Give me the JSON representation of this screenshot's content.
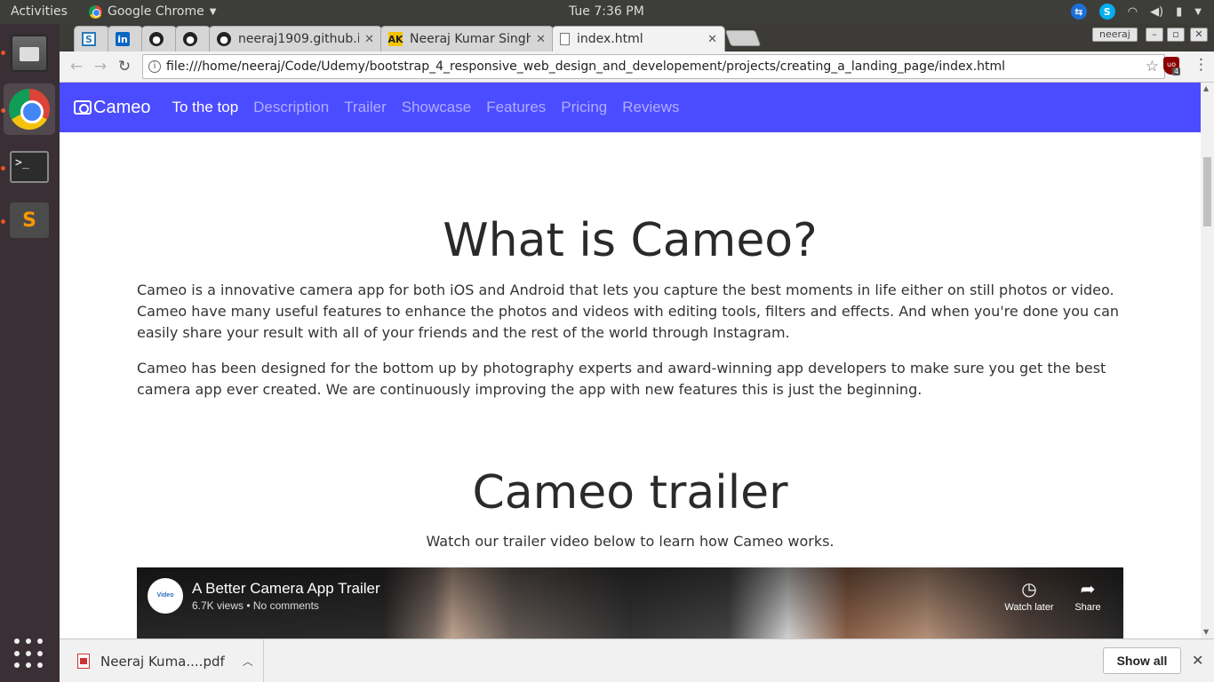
{
  "system_bar": {
    "activities": "Activities",
    "app_name": "Google Chrome",
    "clock": "Tue  7:36 PM"
  },
  "browser": {
    "tabs": [
      {
        "label": "",
        "favicon": "S"
      },
      {
        "label": "",
        "favicon": "in"
      },
      {
        "label": "",
        "favicon": "github"
      },
      {
        "label": "",
        "favicon": "github"
      },
      {
        "label": "neeraj1909.github.i",
        "favicon": "github"
      },
      {
        "label": "Neeraj Kumar Singh",
        "favicon": "AK"
      },
      {
        "label": "index.html",
        "favicon": "page"
      }
    ],
    "profile": "neeraj",
    "url": "file:///home/neeraj/Code/Udemy/bootstrap_4_responsive_web_design_and_developement/projects/creating_a_landing_page/index.html",
    "extension_badge": "4"
  },
  "site": {
    "brand": "Cameo",
    "nav": [
      "To the top",
      "Description",
      "Trailer",
      "Showcase",
      "Features",
      "Pricing",
      "Reviews"
    ],
    "active_nav": "To the top",
    "about": {
      "heading": "What is Cameo?",
      "p1": "Cameo is a innovative camera app for both iOS and Android that lets you capture the best moments in life either on still photos or video. Cameo have many useful features to enhance the photos and videos with editing tools, filters and effects. And when you're done you can easily share your result with all of your friends and the rest of the world through Instagram.",
      "p2": "Cameo has been designed for the bottom up by photography experts and award-winning app developers to make sure you get the best camera app ever created. We are continuously improving the app with new features this is just the beginning."
    },
    "trailer": {
      "heading": "Cameo trailer",
      "subtitle": "Watch our trailer video below to learn how Cameo works.",
      "video_title": "A Better Camera App Trailer",
      "video_meta": "6.7K views • No comments",
      "channel_label": "Video",
      "watch_later": "Watch later",
      "share": "Share"
    }
  },
  "downloads": {
    "file": "Neeraj Kuma....pdf",
    "show_all": "Show all"
  },
  "colors": {
    "nav_bg": "#4b4bff",
    "ubuntu_accent": "#e95420"
  }
}
